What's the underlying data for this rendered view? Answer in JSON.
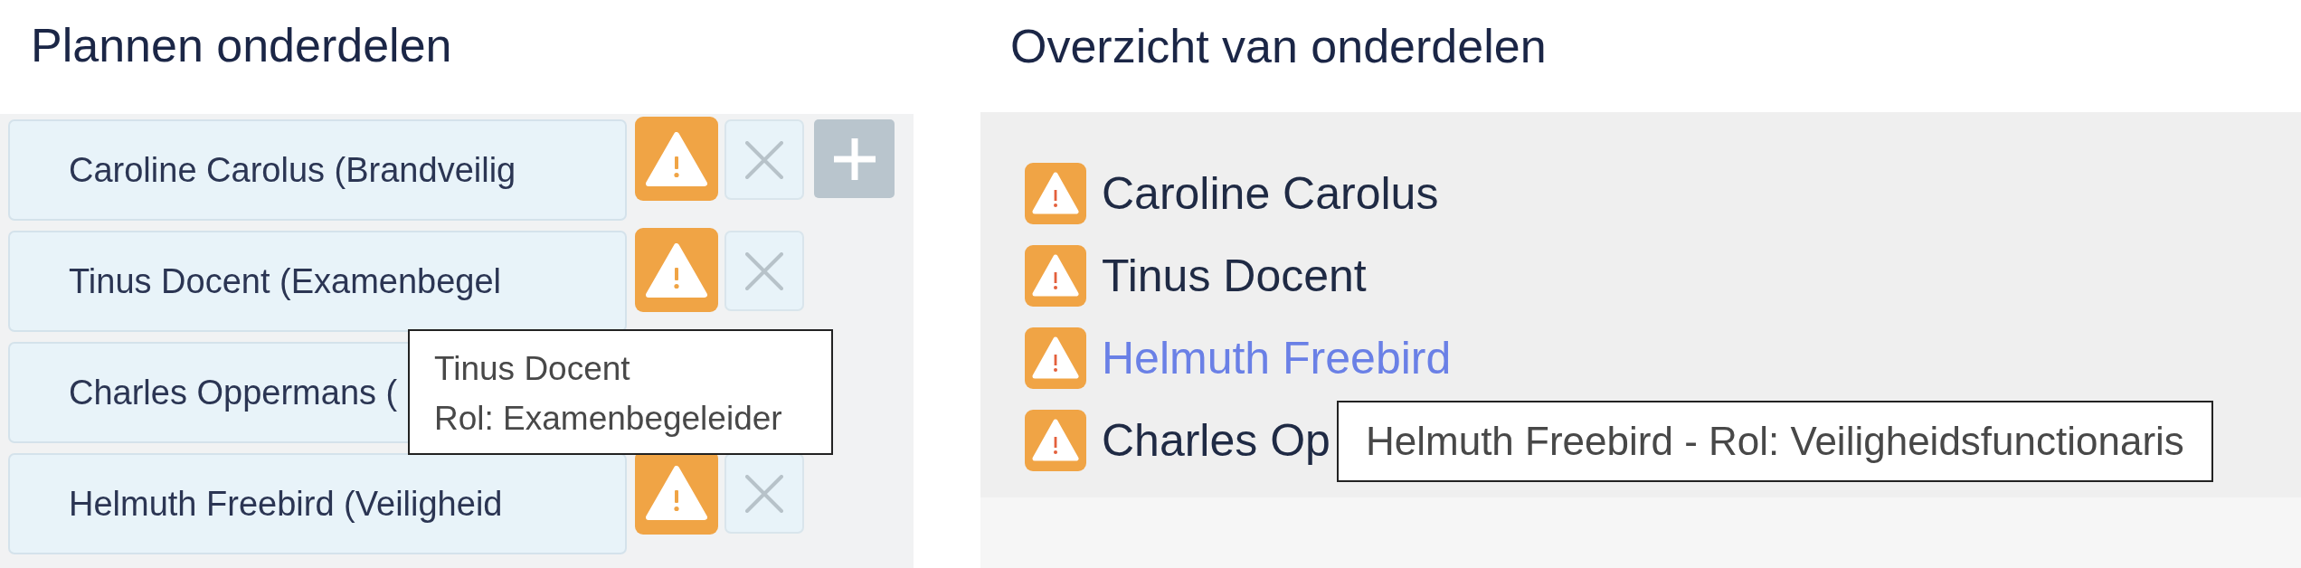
{
  "planning": {
    "title": "Plannen onderdelen",
    "rows": [
      {
        "label": "Caroline Carolus (Brandveilig",
        "buttons": [
          {
            "kind": "warning"
          },
          {
            "kind": "remove"
          },
          {
            "kind": "add"
          }
        ]
      },
      {
        "label": "Tinus Docent (Examenbegel",
        "buttons": [
          {
            "kind": "warning"
          },
          {
            "kind": "remove"
          }
        ]
      },
      {
        "label": "Charles Oppermans ("
      },
      {
        "label": "Helmuth Freebird (Veiligheid",
        "buttons": [
          {
            "kind": "warning"
          },
          {
            "kind": "remove"
          }
        ]
      }
    ],
    "tooltip": {
      "lines": [
        "Tinus Docent",
        "Rol: Examenbegeleider"
      ]
    }
  },
  "overview": {
    "title": "Overzicht van onderdelen",
    "items": [
      {
        "label": "Caroline Carolus",
        "warning": true,
        "hovered": false
      },
      {
        "label": "Tinus Docent",
        "warning": true,
        "hovered": false
      },
      {
        "label": "Helmuth Freebird",
        "warning": true,
        "hovered": true
      },
      {
        "label": "Charles Op",
        "warning": true,
        "hovered": false
      }
    ],
    "tooltip": {
      "text": "Helmuth Freebird - Rol: Veiligheidsfunctionaris"
    }
  }
}
